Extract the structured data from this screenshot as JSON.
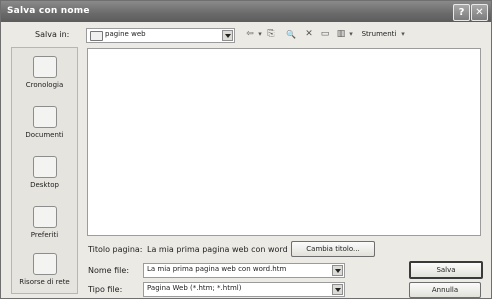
{
  "window": {
    "title": "Salva con nome",
    "help_glyph": "?",
    "close_glyph": "✕"
  },
  "save_in": {
    "label": "Salva in:",
    "value": "pagine web"
  },
  "toolbar": {
    "back_glyph": "⇦",
    "up_glyph": "⎘",
    "search_glyph": "🔍",
    "delete_glyph": "✕",
    "newfolder_glyph": "▭",
    "views_glyph": "▥",
    "tools_label": "Strumenti",
    "dropdown_glyph": "▾"
  },
  "places": [
    {
      "label": "Cronologia",
      "icon": "history-icon"
    },
    {
      "label": "Documenti",
      "icon": "documents-icon"
    },
    {
      "label": "Desktop",
      "icon": "desktop-icon"
    },
    {
      "label": "Preferiti",
      "icon": "favorites-icon"
    },
    {
      "label": "Risorse di rete",
      "icon": "network-icon"
    }
  ],
  "page_title": {
    "label": "Titolo pagina:",
    "value": "La mia prima pagina web con word",
    "change_button": "Cambia titolo..."
  },
  "file_name": {
    "label": "Nome file:",
    "value": "La mia prima pagina web con word.htm"
  },
  "file_type": {
    "label": "Tipo file:",
    "value": "Pagina Web (*.htm; *.html)"
  },
  "buttons": {
    "save": "Salva",
    "cancel": "Annulla"
  }
}
